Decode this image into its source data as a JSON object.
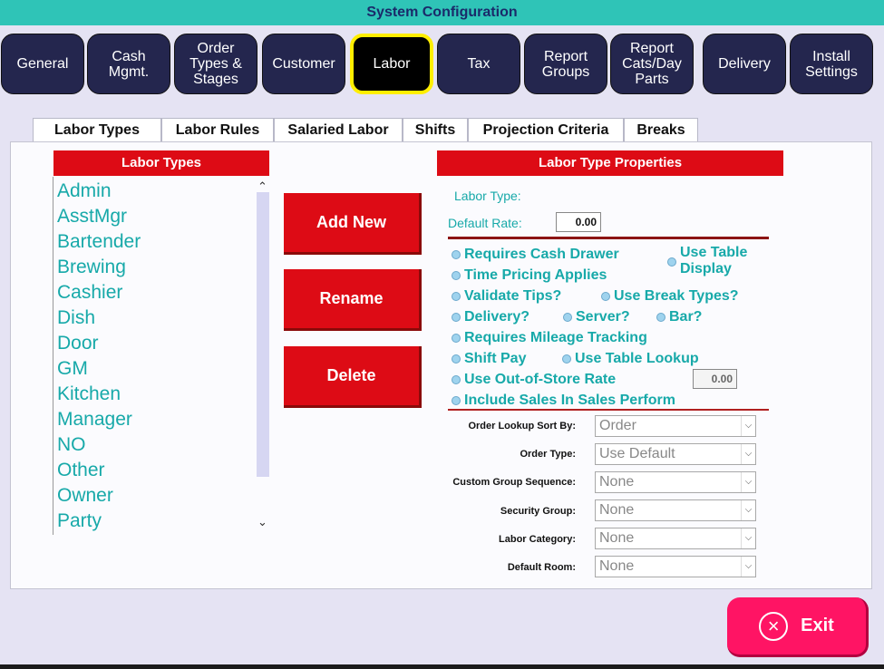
{
  "title": "System Configuration",
  "nav": [
    {
      "label": "General"
    },
    {
      "label": "Cash\nMgmt."
    },
    {
      "label": "Order\nTypes &\nStages"
    },
    {
      "label": "Customer"
    },
    {
      "label": "Labor",
      "active": true
    },
    {
      "label": "Tax"
    },
    {
      "label": "Report\nGroups"
    },
    {
      "label": "Report\nCats/Day\nParts"
    },
    {
      "label": "Delivery"
    },
    {
      "label": "Install\nSettings"
    }
  ],
  "subtabs": [
    "Labor Types",
    "Labor Rules",
    "Salaried Labor",
    "Shifts",
    "Projection Criteria",
    "Breaks"
  ],
  "labor_types": {
    "header": "Labor Types",
    "items": [
      "Admin",
      "AsstMgr",
      "Bartender",
      "Brewing",
      "Cashier",
      "Dish",
      "Door",
      "GM",
      "Kitchen",
      "Manager",
      "NO",
      "Other",
      "Owner",
      "Party"
    ]
  },
  "actions": {
    "add_new": "Add New",
    "rename": "Rename",
    "delete": "Delete"
  },
  "properties": {
    "header": "Labor Type Properties",
    "labor_type_label": "Labor Type:",
    "default_rate_label": "Default Rate:",
    "default_rate_value": "0.00",
    "options": {
      "requires_cash_drawer": "Requires Cash Drawer",
      "use_table_display_1": "Use Table",
      "use_table_display_2": "Display",
      "time_pricing_applies": "Time Pricing Applies",
      "validate_tips": "Validate Tips?",
      "use_break_types": "Use Break Types?",
      "delivery": "Delivery?",
      "server": "Server?",
      "bar": "Bar?",
      "requires_mileage_tracking": "Requires Mileage Tracking",
      "shift_pay": "Shift Pay",
      "use_table_lookup": "Use Table Lookup",
      "use_out_of_store_rate": "Use Out-of-Store Rate",
      "out_of_store_rate_value": "0.00",
      "include_sales": "Include Sales In Sales Perform"
    },
    "fields": [
      {
        "label": "Order Lookup Sort By:",
        "value": "Order"
      },
      {
        "label": "Order Type:",
        "value": "Use Default"
      },
      {
        "label": "Custom Group Sequence:",
        "value": "None"
      },
      {
        "label": "Security Group:",
        "value": "None"
      },
      {
        "label": "Labor Category:",
        "value": "None"
      },
      {
        "label": "Default Room:",
        "value": "None"
      }
    ]
  },
  "exit_label": "Exit"
}
